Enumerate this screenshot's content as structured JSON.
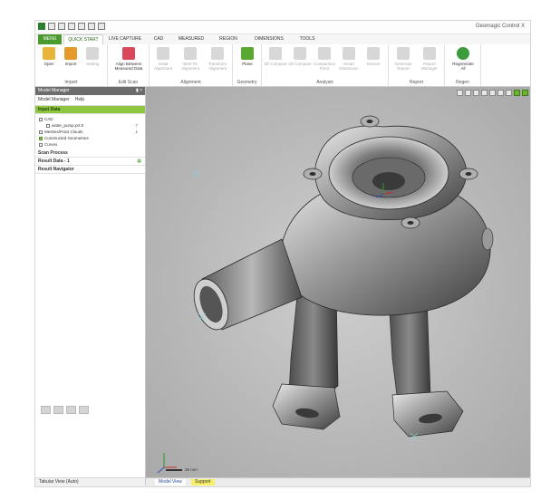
{
  "app_title": "Geomagic Control X",
  "tabs": [
    "MENU",
    "QUICK START",
    "LIVE CAPTURE",
    "CAD",
    "MEASURED",
    "REGION",
    "DIMENSIONS",
    "TOOLS"
  ],
  "ribbon": {
    "groups": [
      {
        "label": "Import",
        "buttons": [
          {
            "label": "Open",
            "icon": "open-icon",
            "enabled": true
          },
          {
            "label": "Import",
            "icon": "import-icon",
            "enabled": true
          },
          {
            "label": "Setting",
            "icon": "setting-icon",
            "enabled": false
          }
        ]
      },
      {
        "label": "Edit Scan",
        "buttons": [
          {
            "label": "Align Between Measured Data",
            "icon": "align-icon",
            "enabled": true
          }
        ]
      },
      {
        "label": "Alignment",
        "buttons": [
          {
            "label": "Initial Alignment",
            "icon": "initial-alignment-icon",
            "enabled": false
          },
          {
            "label": "Best Fit Alignment",
            "icon": "best-fit-icon",
            "enabled": false
          },
          {
            "label": "Transform Alignment",
            "icon": "transform-icon",
            "enabled": false
          }
        ]
      },
      {
        "label": "Geometry",
        "buttons": [
          {
            "label": "Plane",
            "icon": "plane-icon",
            "enabled": true
          }
        ]
      },
      {
        "label": "Analysis",
        "buttons": [
          {
            "label": "3D Compare",
            "icon": "compare-3d-icon",
            "enabled": false
          },
          {
            "label": "2D Compare",
            "icon": "compare-2d-icon",
            "enabled": false
          },
          {
            "label": "Comparison Point",
            "icon": "comparison-point-icon",
            "enabled": false
          },
          {
            "label": "Smart Dimension",
            "icon": "smart-dimension-icon",
            "enabled": false
          },
          {
            "label": "Section",
            "icon": "section-icon",
            "enabled": false
          }
        ]
      },
      {
        "label": "Report",
        "buttons": [
          {
            "label": "Generate Report",
            "icon": "generate-report-icon",
            "enabled": false
          },
          {
            "label": "Report Manager",
            "icon": "report-manager-icon",
            "enabled": false
          }
        ]
      },
      {
        "label": "Regen",
        "buttons": [
          {
            "label": "Regenerate All",
            "icon": "regenerate-icon",
            "enabled": true
          }
        ]
      }
    ]
  },
  "panel": {
    "title": "Model Manager",
    "tabs": [
      "Model Manager",
      "Help"
    ],
    "input_data": "Input Data",
    "tree": [
      {
        "label": "CAD",
        "value": ""
      },
      {
        "label": "water_pump.prt.8",
        "value": "7"
      },
      {
        "label": "Meshes/Point Clouds",
        "value": "1"
      },
      {
        "label": "Constructed Geometries",
        "value": ""
      },
      {
        "label": "Curves",
        "value": ""
      }
    ],
    "scan_process": "Scan Process",
    "result_data": "Result Data - 1",
    "result_navigator": "Result Navigator",
    "status": "Tabular View (Auto)"
  },
  "viewport": {
    "scale_label": "25 mm"
  },
  "bottom_tabs": [
    "Model View",
    "Support"
  ],
  "colors": {
    "accent": "#4a9a2f",
    "highlight": "#8ec63f",
    "support_tab": "#f7f06a"
  }
}
